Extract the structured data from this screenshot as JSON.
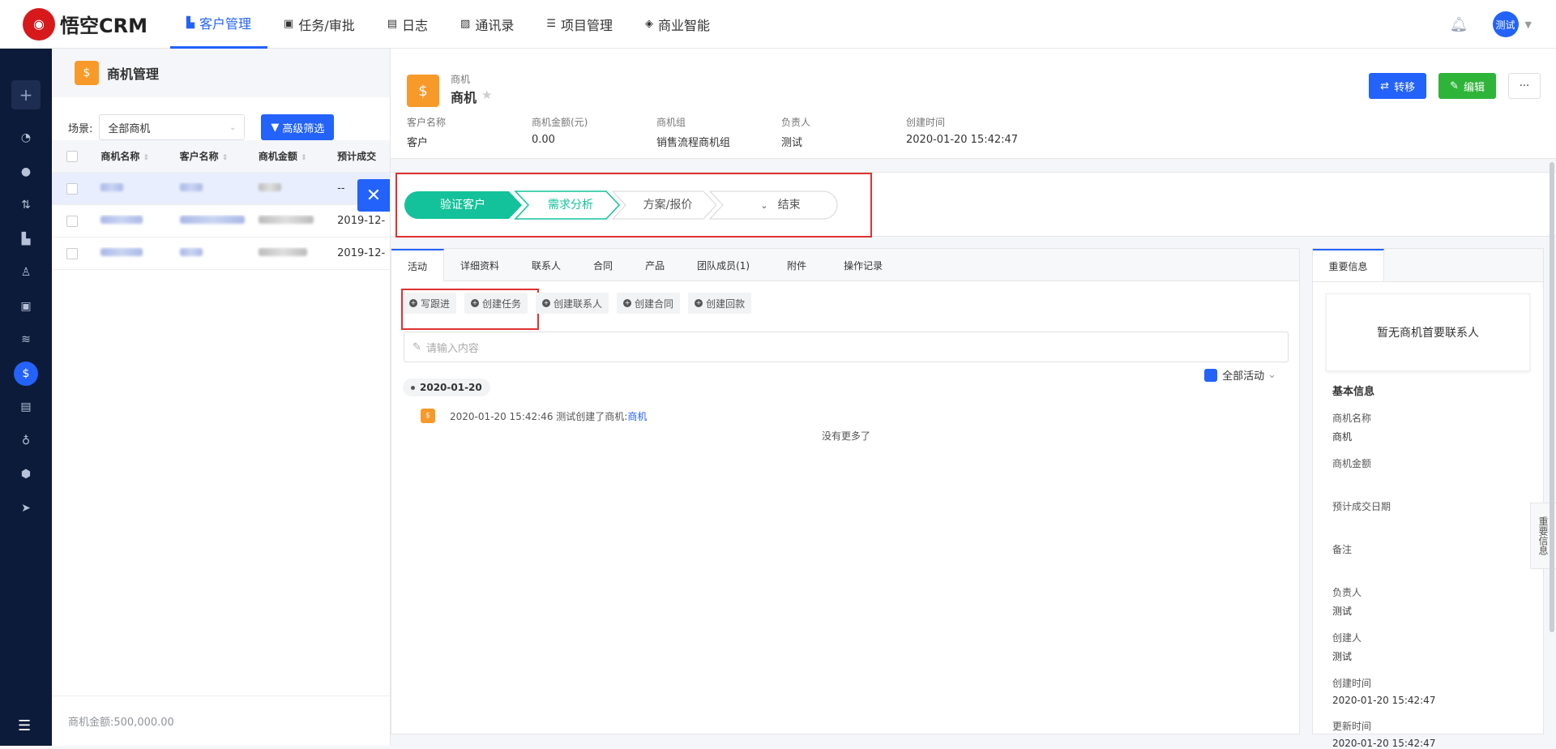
{
  "app": {
    "logo_text": "悟空CRM"
  },
  "nav": [
    {
      "icon": "contacts-book-icon",
      "label": "客户管理",
      "active": true
    },
    {
      "icon": "briefcase-icon",
      "label": "任务/审批",
      "active": false
    },
    {
      "icon": "document-icon",
      "label": "日志",
      "active": false
    },
    {
      "icon": "phone-book-icon",
      "label": "通讯录",
      "active": false
    },
    {
      "icon": "list-icon",
      "label": "项目管理",
      "active": false
    },
    {
      "icon": "shield-icon",
      "label": "商业智能",
      "active": false
    }
  ],
  "user": {
    "avatar_text": "测试"
  },
  "list": {
    "title": "商机管理",
    "scene_label": "场景:",
    "scene_value": "全部商机",
    "filter_button": "高级筛选",
    "columns": [
      "商机名称",
      "客户名称",
      "商机金额",
      "预计成交"
    ],
    "rows": [
      {
        "date": "--"
      },
      {
        "date": "2019-12-"
      },
      {
        "date": "2019-12-"
      }
    ],
    "footer": "商机金额:500,000.00"
  },
  "detail": {
    "kind": "商机",
    "name": "商机",
    "buttons": {
      "transfer": "转移",
      "edit": "编辑",
      "more": "···"
    },
    "meta": [
      {
        "label": "客户名称",
        "value": "客户"
      },
      {
        "label": "商机金额(元)",
        "value": "0.00"
      },
      {
        "label": "商机组",
        "value": "销售流程商机组"
      },
      {
        "label": "负责人",
        "value": "测试"
      },
      {
        "label": "创建时间",
        "value": "2020-01-20 15:42:47"
      }
    ],
    "stages": [
      "验证客户",
      "需求分析",
      "方案/报价",
      "结束"
    ],
    "tabs": [
      "活动",
      "详细资料",
      "联系人",
      "合同",
      "产品",
      "团队成员(1)",
      "附件",
      "操作记录"
    ],
    "actions": [
      "写跟进",
      "创建任务",
      "创建联系人",
      "创建合同",
      "创建回款"
    ],
    "input_placeholder": "请输入内容",
    "filter_all": "全部活动",
    "date": "2020-01-20",
    "log_text": "2020-01-20 15:42:46 测试创建了商机:",
    "log_link": "商机",
    "no_more": "没有更多了"
  },
  "side": {
    "tab": "重要信息",
    "no_contact": "暂无商机首要联系人",
    "section": "基本信息",
    "fields": [
      {
        "label": "商机名称",
        "value": "商机"
      },
      {
        "label": "商机金额",
        "value": ""
      },
      {
        "label": "预计成交日期",
        "value": ""
      },
      {
        "label": "备注",
        "value": ""
      },
      {
        "label": "负责人",
        "value": "测试"
      },
      {
        "label": "创建人",
        "value": "测试"
      },
      {
        "label": "创建时间",
        "value": "2020-01-20 15:42:47"
      },
      {
        "label": "更新时间",
        "value": "2020-01-20 15:42:47"
      }
    ],
    "edge_tab": "重要信息"
  },
  "colors": {
    "primary": "#2362fb",
    "success": "#2fb43a",
    "stage_active": "#13c29a",
    "highlight": "#e03131",
    "orange": "#f79a29"
  }
}
